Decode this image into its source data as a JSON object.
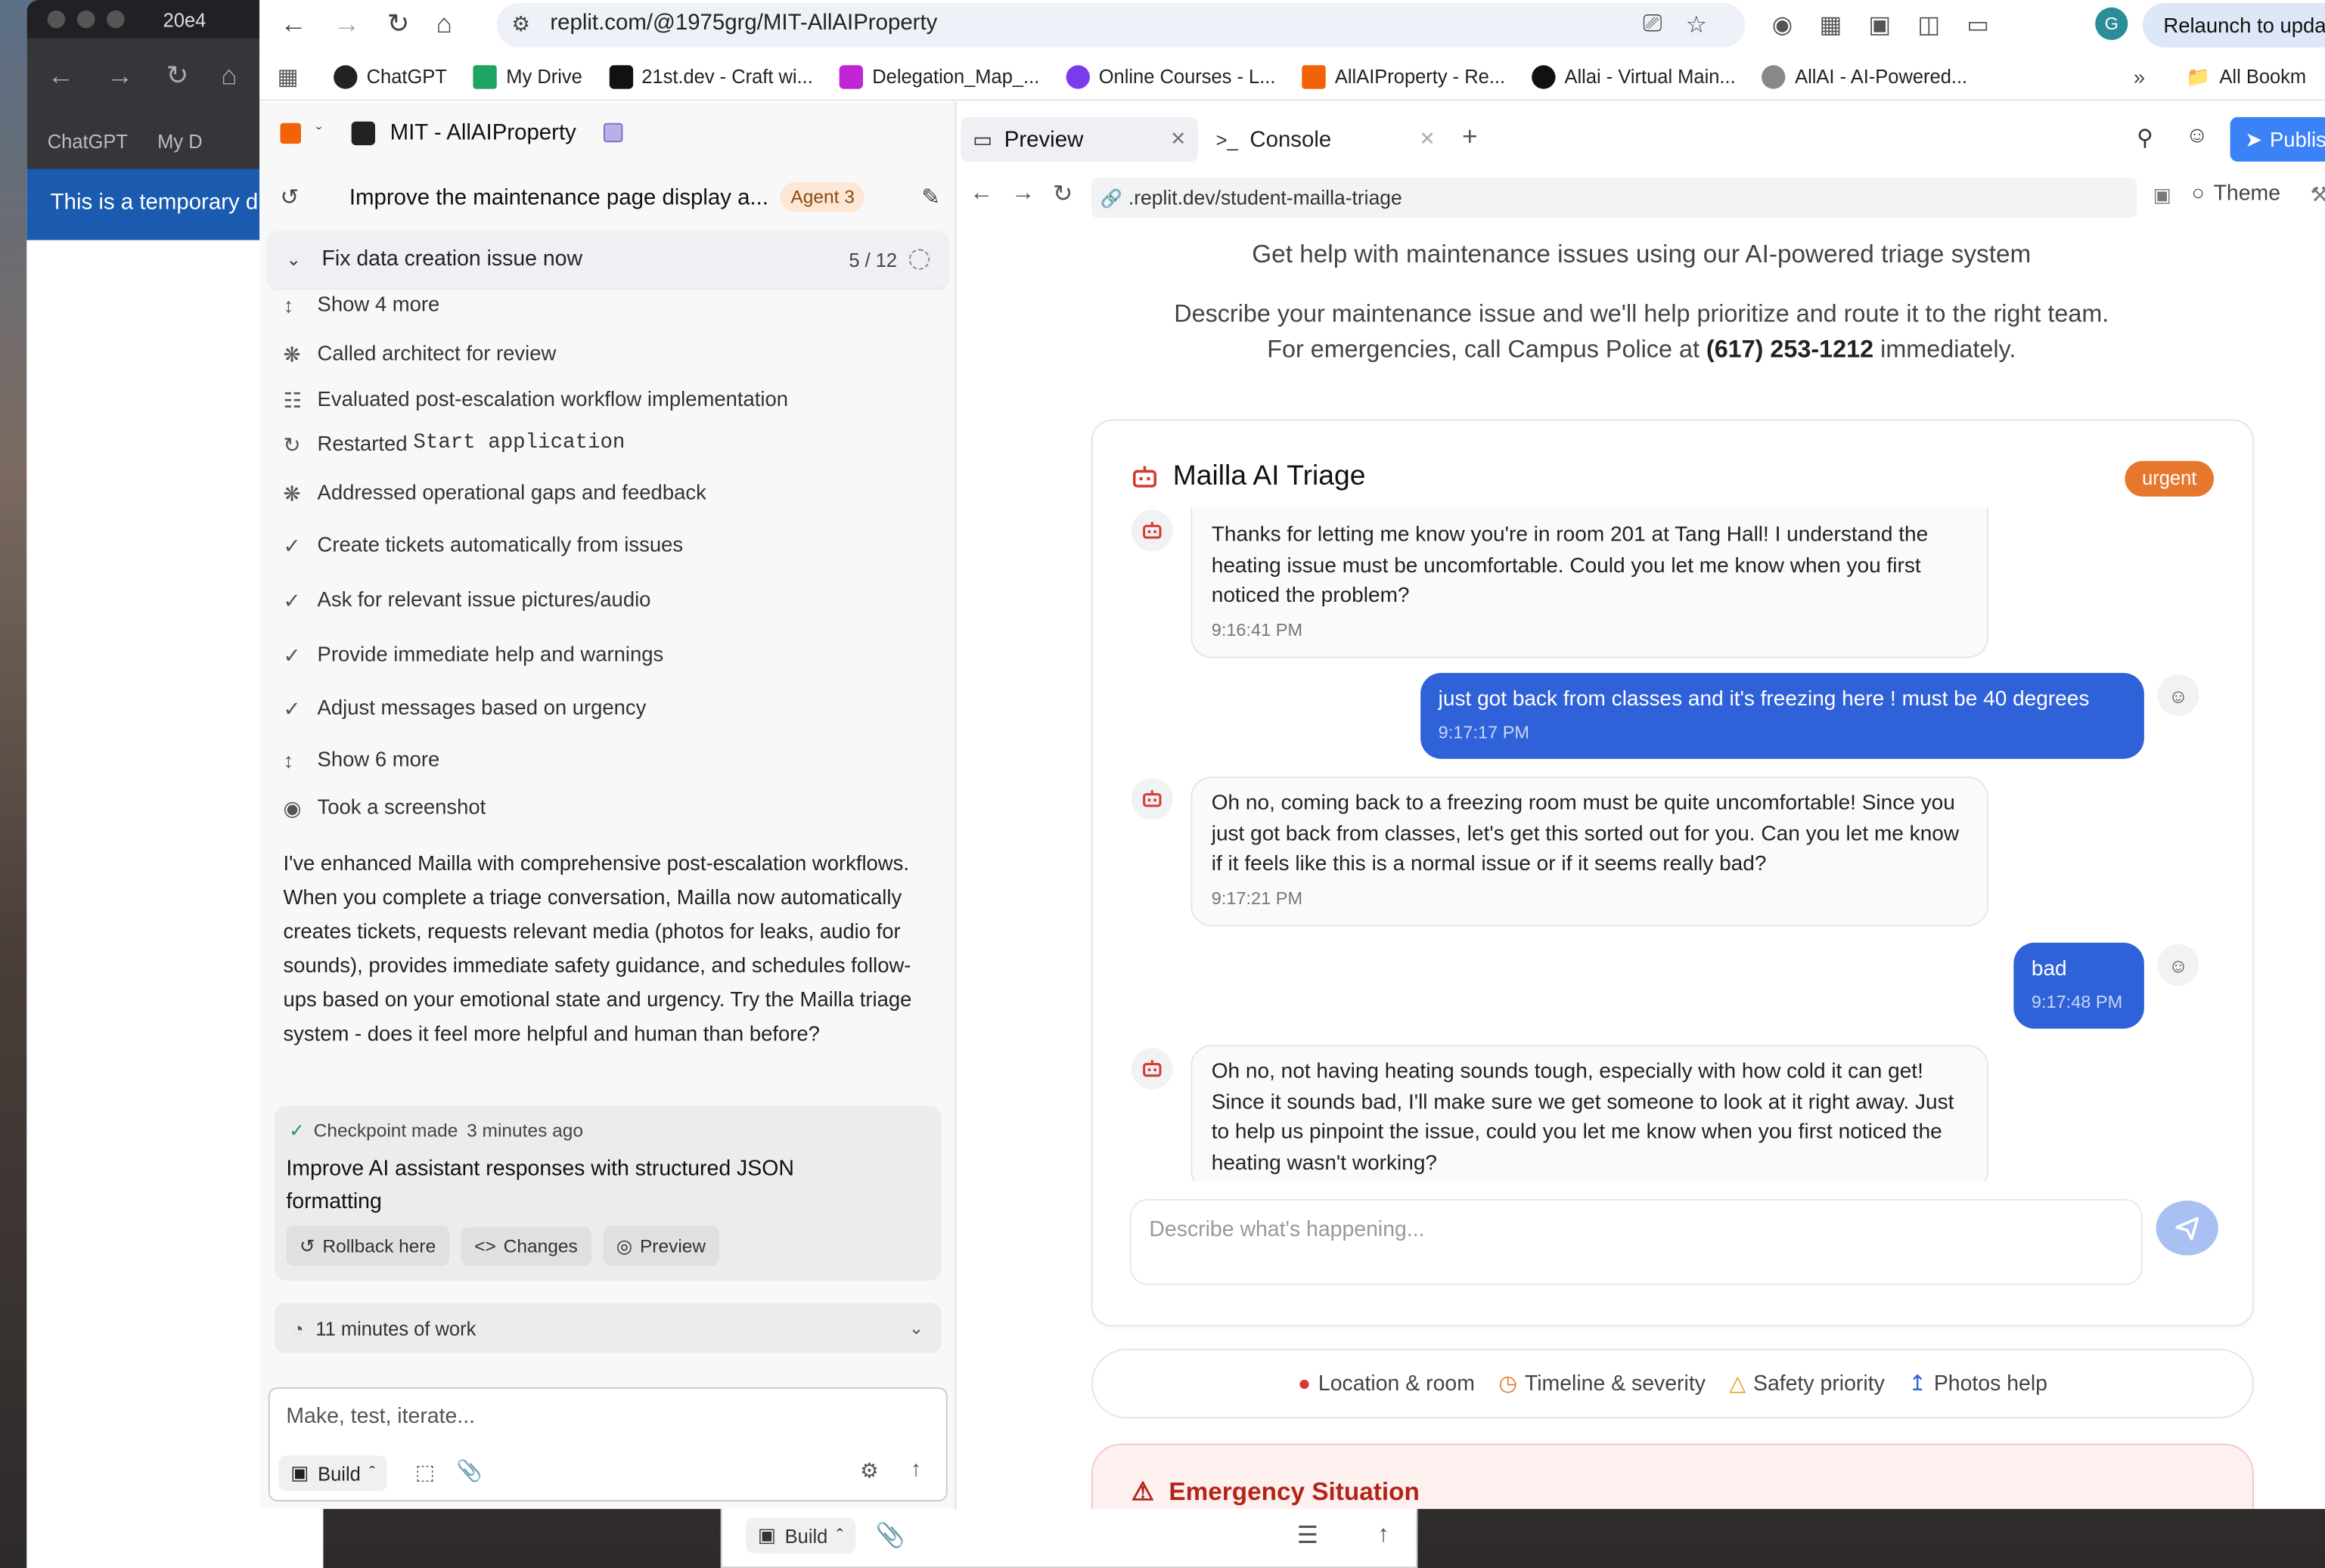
{
  "browser": {
    "tab_partial": "20e4",
    "url": "replit.com/@1975grg/MIT-AllAIProperty",
    "relaunch": "Relaunch to upda",
    "profile_initial": "G",
    "bookmarks": [
      "ChatGPT",
      "My Drive",
      "21st.dev - Craft wi...",
      "Delegation_Map_...",
      "Online Courses - L...",
      "AllAIProperty - Re...",
      "Allai - Virtual Main...",
      "AllAI - AI-Powered..."
    ],
    "all_bookmarks": "All Bookm",
    "back_window": {
      "bookmarks": [
        "ChatGPT",
        "My D"
      ],
      "banner": "This is a temporary d"
    }
  },
  "workspace": {
    "project": "MIT - AllAIProperty",
    "thread_title": "Improve the maintenance page display a...",
    "agent_badge": "Agent 3",
    "task": {
      "label": "Fix data creation issue now",
      "progress": "5 / 12"
    },
    "activity": [
      {
        "icon": "expand-icon",
        "text": "Show 4 more",
        "mono": ""
      },
      {
        "icon": "brain-icon",
        "text": "Called architect for review",
        "mono": ""
      },
      {
        "icon": "scan-icon",
        "text": "Evaluated post-escalation workflow implementation",
        "mono": ""
      },
      {
        "icon": "restart-icon",
        "text": "Restarted ",
        "mono": "Start application"
      },
      {
        "icon": "brain-icon",
        "text": "Addressed operational gaps and feedback",
        "mono": ""
      },
      {
        "icon": "check-icon",
        "text": "Create tickets automatically from issues",
        "mono": ""
      },
      {
        "icon": "check-icon",
        "text": "Ask for relevant issue pictures/audio",
        "mono": ""
      },
      {
        "icon": "check-icon",
        "text": "Provide immediate help and warnings",
        "mono": ""
      },
      {
        "icon": "check-icon",
        "text": "Adjust messages based on urgency",
        "mono": ""
      },
      {
        "icon": "expand-icon",
        "text": "Show 6 more",
        "mono": ""
      },
      {
        "icon": "camera-icon",
        "text": "Took a screenshot",
        "mono": ""
      }
    ],
    "summary": "I've enhanced Mailla with comprehensive post-escalation workflows. When you complete a triage conversation, Mailla now automatically creates tickets, requests relevant media (photos for leaks, audio for sounds), provides immediate safety guidance, and schedules follow-ups based on your emotional state and urgency. Try the Mailla triage system - does it feel more helpful and human than before?",
    "checkpoint": {
      "made": "Checkpoint made",
      "ago": "3 minutes ago",
      "title": "Improve AI assistant responses with structured JSON formatting",
      "buttons": [
        "Rollback here",
        "Changes",
        "Preview"
      ]
    },
    "work_time": "11 minutes of work",
    "composer_placeholder": "Make, test, iterate...",
    "build_label": "Build"
  },
  "preview_tabs": {
    "tabs": [
      "Preview",
      "Console"
    ],
    "publish": "Publish",
    "address": ".replit.dev/student-mailla-triage",
    "theme": "Theme"
  },
  "page": {
    "subtitle": "Get help with maintenance issues using our AI-powered triage system",
    "intro_line1": "Describe your maintenance issue and we'll help prioritize and route it to the right team.",
    "intro_line2_pre": "For emergencies, call Campus Police at ",
    "phone": "(617) 253-1212",
    "intro_line2_post": " immediately.",
    "chat": {
      "title": "Mailla AI Triage",
      "urgency": "urgent",
      "messages": [
        {
          "role": "bot",
          "text": "Thanks for letting me know you're in room 201 at Tang Hall! I understand the heating issue must be uncomfortable. Could you let me know when you first noticed the problem?",
          "time": "9:16:41 PM"
        },
        {
          "role": "user",
          "text": "just got back from classes and it's freezing here  ! must be 40 degrees",
          "time": "9:17:17 PM"
        },
        {
          "role": "bot",
          "text": "Oh no, coming back to a freezing room must be quite uncomfortable! Since you just got back from classes, let's get this sorted out for you. Can you let me know if it feels like this is a normal issue or if it seems really bad?",
          "time": "9:17:21 PM"
        },
        {
          "role": "user",
          "text": "bad",
          "time": "9:17:48 PM"
        },
        {
          "role": "bot",
          "text": "Oh no, not having heating sounds tough, especially with how cold it can get! Since it sounds bad, I'll make sure we get someone to look at it right away. Just to help us pinpoint the issue, could you let me know when you first noticed the heating wasn't working?",
          "time": ""
        }
      ],
      "input_placeholder": "Describe what's happening..."
    },
    "tips": [
      "Location & room",
      "Timeline & severity",
      "Safety priority",
      "Photos help"
    ],
    "emergency_partial": "Emergency Situation"
  },
  "colors": {
    "accent": "#2f62d8",
    "urgent": "#e8772e",
    "send": "#a8c0f2",
    "agent_badge": "#fde7d4"
  }
}
